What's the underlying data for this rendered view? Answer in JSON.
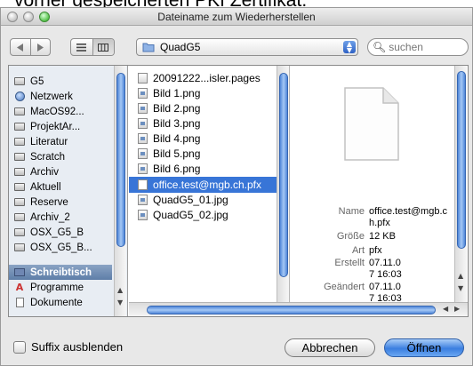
{
  "background_text": "vorher gespeicherten PKI Zertifikat.",
  "window": {
    "title": "Dateiname zum Wiederherstellen"
  },
  "toolbar": {
    "back_icon": "triangle-left",
    "forward_icon": "triangle-right",
    "list_view_icon": "list-lines",
    "column_view_icon": "columns",
    "path_label": "QuadG5",
    "search_placeholder": "suchen"
  },
  "sidebar": {
    "items": [
      {
        "label": "G5",
        "icon": "drive-icon"
      },
      {
        "label": "Netzwerk",
        "icon": "network-globe-icon"
      },
      {
        "label": "MacOS92...",
        "icon": "drive-icon"
      },
      {
        "label": "ProjektAr...",
        "icon": "drive-icon"
      },
      {
        "label": "Literatur",
        "icon": "drive-icon"
      },
      {
        "label": "Scratch",
        "icon": "drive-icon"
      },
      {
        "label": "Archiv",
        "icon": "drive-icon"
      },
      {
        "label": "Aktuell",
        "icon": "drive-icon"
      },
      {
        "label": "Reserve",
        "icon": "drive-icon"
      },
      {
        "label": "Archiv_2",
        "icon": "drive-icon"
      },
      {
        "label": "OSX_G5_B",
        "icon": "drive-icon"
      },
      {
        "label": "OSX_G5_B...",
        "icon": "drive-icon"
      },
      {
        "label": "Schreibtisch",
        "icon": "desktop-icon",
        "selected": true
      },
      {
        "label": "Programme",
        "icon": "applications-icon"
      },
      {
        "label": "Dokumente",
        "icon": "documents-icon"
      }
    ]
  },
  "files": {
    "items": [
      {
        "label": "20091222...isler.pages",
        "icon": "pages-doc-icon"
      },
      {
        "label": "Bild 1.png",
        "icon": "image-file-icon"
      },
      {
        "label": "Bild 2.png",
        "icon": "image-file-icon"
      },
      {
        "label": "Bild 3.png",
        "icon": "image-file-icon"
      },
      {
        "label": "Bild 4.png",
        "icon": "image-file-icon"
      },
      {
        "label": "Bild 5.png",
        "icon": "image-file-icon"
      },
      {
        "label": "Bild 6.png",
        "icon": "image-file-icon"
      },
      {
        "label": "office.test@mgb.ch.pfx",
        "icon": "blank-file-icon",
        "selected": true
      },
      {
        "label": "QuadG5_01.jpg",
        "icon": "image-file-icon"
      },
      {
        "label": "QuadG5_02.jpg",
        "icon": "image-file-icon"
      }
    ]
  },
  "preview": {
    "icon": "blank-document-icon",
    "name_label": "Name",
    "name_value": "office.test@mgb.ch.pfx",
    "size_label": "Größe",
    "size_value": "12 KB",
    "kind_label": "Art",
    "kind_value": "pfx",
    "created_label": "Erstellt",
    "created_value": "07.11.07 16:03",
    "modified_label": "Geändert",
    "modified_value": "07.11.07 16:03"
  },
  "footer": {
    "hide_extension_label": "Suffix ausblenden",
    "cancel_label": "Abbrechen",
    "open_label": "Öffnen"
  },
  "colors": {
    "selection": "#3875d7",
    "sidebar_selection": "#6e8cb4",
    "primary_button": "#3a7ee0"
  }
}
